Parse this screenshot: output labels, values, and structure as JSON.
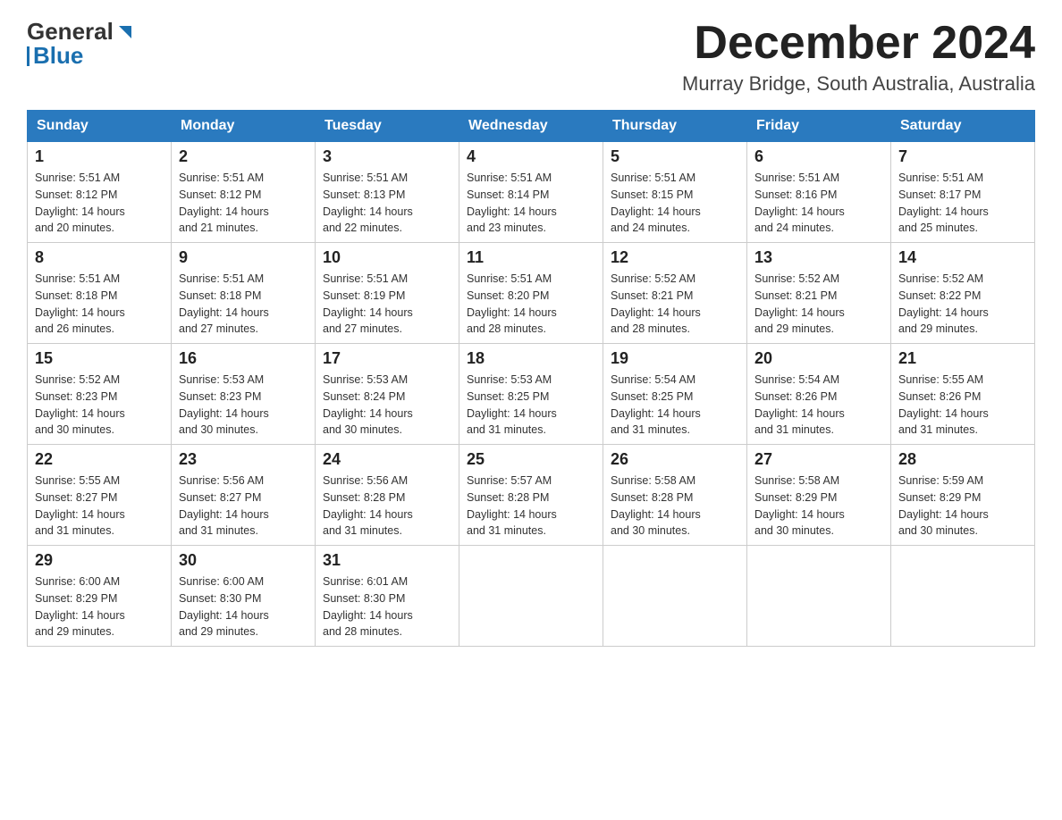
{
  "header": {
    "logo_general": "General",
    "logo_blue": "Blue",
    "month_title": "December 2024",
    "location": "Murray Bridge, South Australia, Australia"
  },
  "weekdays": [
    "Sunday",
    "Monday",
    "Tuesday",
    "Wednesday",
    "Thursday",
    "Friday",
    "Saturday"
  ],
  "weeks": [
    [
      {
        "day": "1",
        "sunrise": "5:51 AM",
        "sunset": "8:12 PM",
        "daylight": "14 hours and 20 minutes."
      },
      {
        "day": "2",
        "sunrise": "5:51 AM",
        "sunset": "8:12 PM",
        "daylight": "14 hours and 21 minutes."
      },
      {
        "day": "3",
        "sunrise": "5:51 AM",
        "sunset": "8:13 PM",
        "daylight": "14 hours and 22 minutes."
      },
      {
        "day": "4",
        "sunrise": "5:51 AM",
        "sunset": "8:14 PM",
        "daylight": "14 hours and 23 minutes."
      },
      {
        "day": "5",
        "sunrise": "5:51 AM",
        "sunset": "8:15 PM",
        "daylight": "14 hours and 24 minutes."
      },
      {
        "day": "6",
        "sunrise": "5:51 AM",
        "sunset": "8:16 PM",
        "daylight": "14 hours and 24 minutes."
      },
      {
        "day": "7",
        "sunrise": "5:51 AM",
        "sunset": "8:17 PM",
        "daylight": "14 hours and 25 minutes."
      }
    ],
    [
      {
        "day": "8",
        "sunrise": "5:51 AM",
        "sunset": "8:18 PM",
        "daylight": "14 hours and 26 minutes."
      },
      {
        "day": "9",
        "sunrise": "5:51 AM",
        "sunset": "8:18 PM",
        "daylight": "14 hours and 27 minutes."
      },
      {
        "day": "10",
        "sunrise": "5:51 AM",
        "sunset": "8:19 PM",
        "daylight": "14 hours and 27 minutes."
      },
      {
        "day": "11",
        "sunrise": "5:51 AM",
        "sunset": "8:20 PM",
        "daylight": "14 hours and 28 minutes."
      },
      {
        "day": "12",
        "sunrise": "5:52 AM",
        "sunset": "8:21 PM",
        "daylight": "14 hours and 28 minutes."
      },
      {
        "day": "13",
        "sunrise": "5:52 AM",
        "sunset": "8:21 PM",
        "daylight": "14 hours and 29 minutes."
      },
      {
        "day": "14",
        "sunrise": "5:52 AM",
        "sunset": "8:22 PM",
        "daylight": "14 hours and 29 minutes."
      }
    ],
    [
      {
        "day": "15",
        "sunrise": "5:52 AM",
        "sunset": "8:23 PM",
        "daylight": "14 hours and 30 minutes."
      },
      {
        "day": "16",
        "sunrise": "5:53 AM",
        "sunset": "8:23 PM",
        "daylight": "14 hours and 30 minutes."
      },
      {
        "day": "17",
        "sunrise": "5:53 AM",
        "sunset": "8:24 PM",
        "daylight": "14 hours and 30 minutes."
      },
      {
        "day": "18",
        "sunrise": "5:53 AM",
        "sunset": "8:25 PM",
        "daylight": "14 hours and 31 minutes."
      },
      {
        "day": "19",
        "sunrise": "5:54 AM",
        "sunset": "8:25 PM",
        "daylight": "14 hours and 31 minutes."
      },
      {
        "day": "20",
        "sunrise": "5:54 AM",
        "sunset": "8:26 PM",
        "daylight": "14 hours and 31 minutes."
      },
      {
        "day": "21",
        "sunrise": "5:55 AM",
        "sunset": "8:26 PM",
        "daylight": "14 hours and 31 minutes."
      }
    ],
    [
      {
        "day": "22",
        "sunrise": "5:55 AM",
        "sunset": "8:27 PM",
        "daylight": "14 hours and 31 minutes."
      },
      {
        "day": "23",
        "sunrise": "5:56 AM",
        "sunset": "8:27 PM",
        "daylight": "14 hours and 31 minutes."
      },
      {
        "day": "24",
        "sunrise": "5:56 AM",
        "sunset": "8:28 PM",
        "daylight": "14 hours and 31 minutes."
      },
      {
        "day": "25",
        "sunrise": "5:57 AM",
        "sunset": "8:28 PM",
        "daylight": "14 hours and 31 minutes."
      },
      {
        "day": "26",
        "sunrise": "5:58 AM",
        "sunset": "8:28 PM",
        "daylight": "14 hours and 30 minutes."
      },
      {
        "day": "27",
        "sunrise": "5:58 AM",
        "sunset": "8:29 PM",
        "daylight": "14 hours and 30 minutes."
      },
      {
        "day": "28",
        "sunrise": "5:59 AM",
        "sunset": "8:29 PM",
        "daylight": "14 hours and 30 minutes."
      }
    ],
    [
      {
        "day": "29",
        "sunrise": "6:00 AM",
        "sunset": "8:29 PM",
        "daylight": "14 hours and 29 minutes."
      },
      {
        "day": "30",
        "sunrise": "6:00 AM",
        "sunset": "8:30 PM",
        "daylight": "14 hours and 29 minutes."
      },
      {
        "day": "31",
        "sunrise": "6:01 AM",
        "sunset": "8:30 PM",
        "daylight": "14 hours and 28 minutes."
      },
      null,
      null,
      null,
      null
    ]
  ],
  "labels": {
    "sunrise": "Sunrise:",
    "sunset": "Sunset:",
    "daylight": "Daylight:"
  }
}
